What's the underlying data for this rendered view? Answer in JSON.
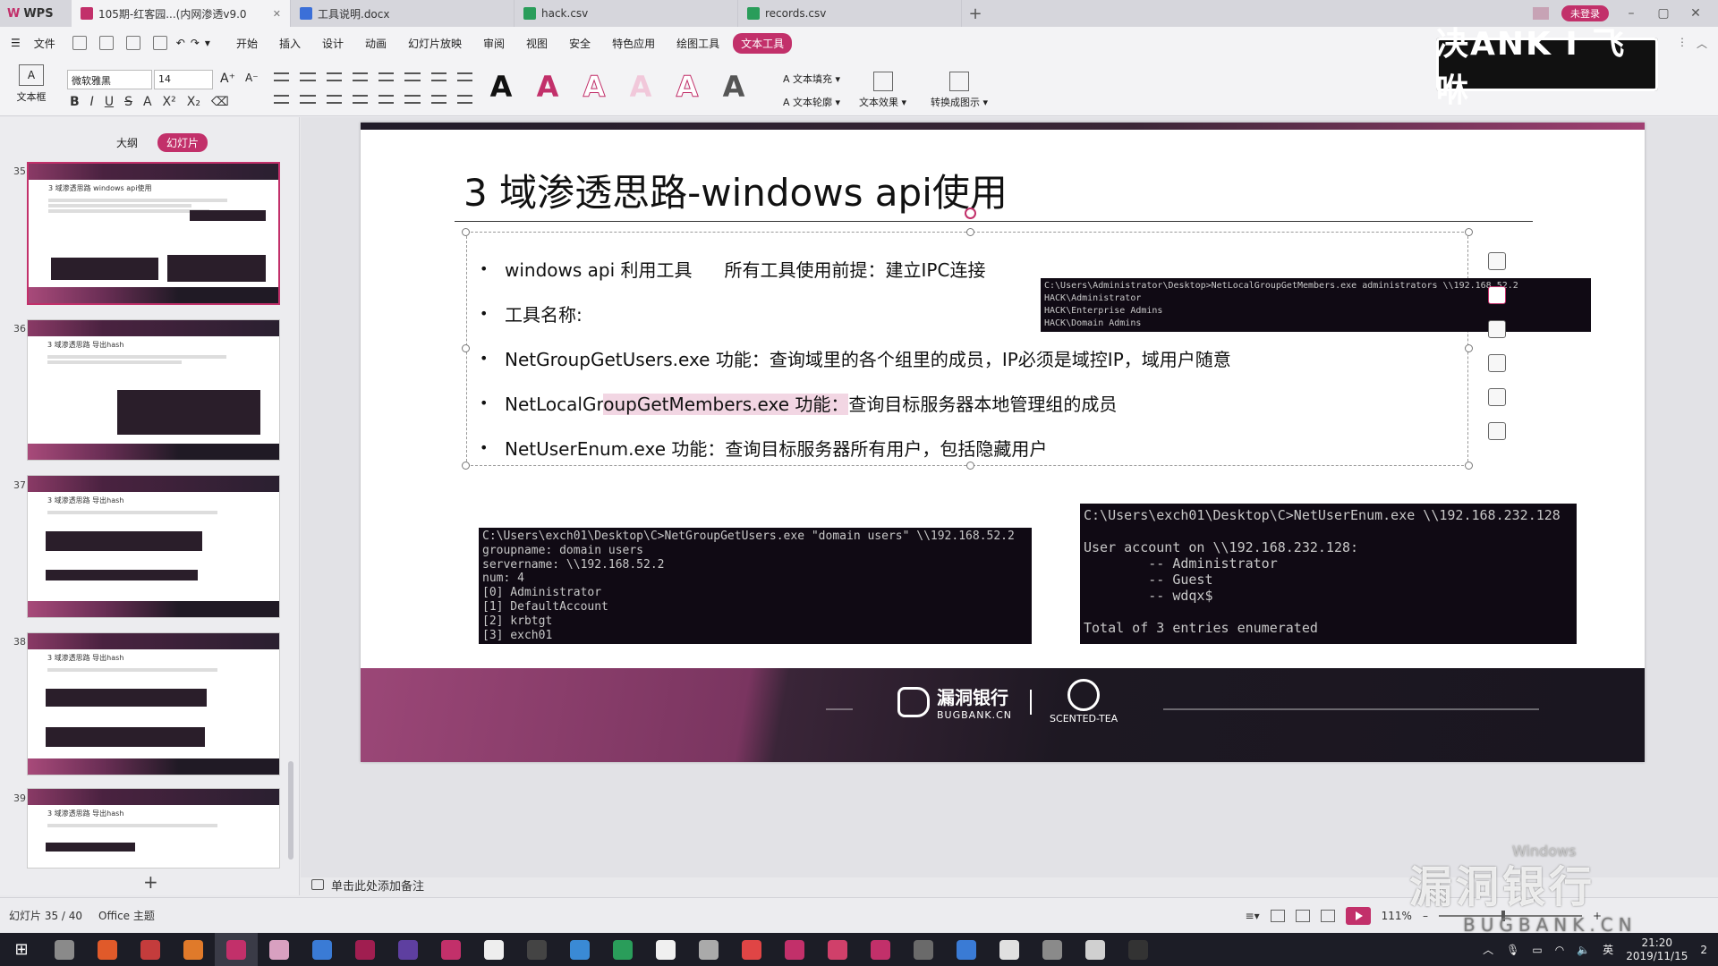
{
  "tabs": [
    {
      "label": "WPS",
      "color": "#c2306a"
    },
    {
      "label": "105期-红客园...(内网渗透v9.0",
      "color": "#c2306a"
    },
    {
      "label": "工具说明.docx",
      "color": "#3b6fd8"
    },
    {
      "label": "hack.csv",
      "color": "#2a9d5a"
    },
    {
      "label": "records.csv",
      "color": "#2a9d5a"
    }
  ],
  "login_badge": "未登录",
  "menu": {
    "file": "文件",
    "items": [
      "开始",
      "插入",
      "设计",
      "动画",
      "幻灯片放映",
      "审阅",
      "视图",
      "安全",
      "特色应用",
      "绘图工具",
      "文本工具"
    ],
    "active": "文本工具"
  },
  "ribbon": {
    "textbox_label": "文本框",
    "font_name": "微软雅黑",
    "font_size": "14",
    "text_fill": "文本填充",
    "text_outline": "文本轮廓",
    "text_effect": "文本效果",
    "convert_shape": "转换成图示"
  },
  "overlay_logo": "决ANK I 飞咻",
  "left_panel": {
    "tab_outline": "大纲",
    "tab_slides": "幻灯片",
    "slide_numbers": [
      "35",
      "36",
      "37",
      "38",
      "39"
    ],
    "thumb_titles": [
      "3 域渗透思路 windows api使用",
      "3 域渗透思路 导出hash",
      "3 域渗透思路 导出hash",
      "3 域渗透思路 导出hash",
      "3 域渗透思路 导出hash"
    ],
    "add_label": "+"
  },
  "slide": {
    "title": "3 域渗透思路-windows api使用",
    "bullets": [
      {
        "main": "windows api 利用工具",
        "extra": "所有工具使用前提：建立IPC连接"
      },
      {
        "main": "工具名称:"
      },
      {
        "main": "NetGroupGetUsers.exe 功能：查询域里的各个组里的成员，IP必须是域控IP，域用户随意"
      },
      {
        "main": "NetLocalGroupGetMembers.exe 功能：查询目标服务器本地管理组的成员"
      },
      {
        "main": "NetUserEnum.exe 功能：查询目标服务器所有用户，包括隐藏用户"
      }
    ],
    "term1": "C:\\Users\\Administrator\\Desktop>NetLocalGroupGetMembers.exe administrators \\\\192.168.52.2\nHACK\\Administrator\nHACK\\Enterprise Admins\nHACK\\Domain Admins",
    "term2": "C:\\Users\\exch01\\Desktop\\C>NetGroupGetUsers.exe \"domain users\" \\\\192.168.52.2\ngroupname: domain users\nservername: \\\\192.168.52.2\nnum: 4\n[0] Administrator\n[1] DefaultAccount\n[2] krbtgt\n[3] exch01",
    "term3": "C:\\Users\\exch01\\Desktop\\C>NetUserEnum.exe \\\\192.168.232.128\n\nUser account on \\\\192.168.232.128:\n        -- Administrator\n        -- Guest\n        -- wdqx$\n\nTotal of 3 entries enumerated",
    "footer_brand1_cn": "漏洞银行",
    "footer_brand1_en": "BUGBANK.CN",
    "footer_brand2": "SCENTED-TEA"
  },
  "notes_placeholder": "单击此处添加备注",
  "status": {
    "slide_counter": "幻灯片 35 / 40",
    "theme": "Office 主题",
    "zoom": "111%"
  },
  "watermark": {
    "cn": "漏洞银行",
    "en": "BUGBANK.CN",
    "windows": "Windows"
  },
  "taskbar": {
    "apps": [
      "#8a8a8a",
      "#e05a2a",
      "#c43c3c",
      "#e07a2a",
      "#c2306a",
      "#d8a0c0",
      "#3a7bd5",
      "#a01e50",
      "#5e3fa0",
      "#c2306a",
      "#eee",
      "#444",
      "#3a8ad5",
      "#2a9d5a",
      "#f0f0f0",
      "#aaa",
      "#e04545",
      "#c2306a",
      "#d0406a",
      "#c2306a",
      "#6a6a6a",
      "#3a7bd5",
      "#e0e0e0",
      "#8a8a8a",
      "#d0d0d0",
      "#333"
    ],
    "ime": "英",
    "time": "21:20",
    "date": "2019/11/15",
    "notify": "2"
  }
}
